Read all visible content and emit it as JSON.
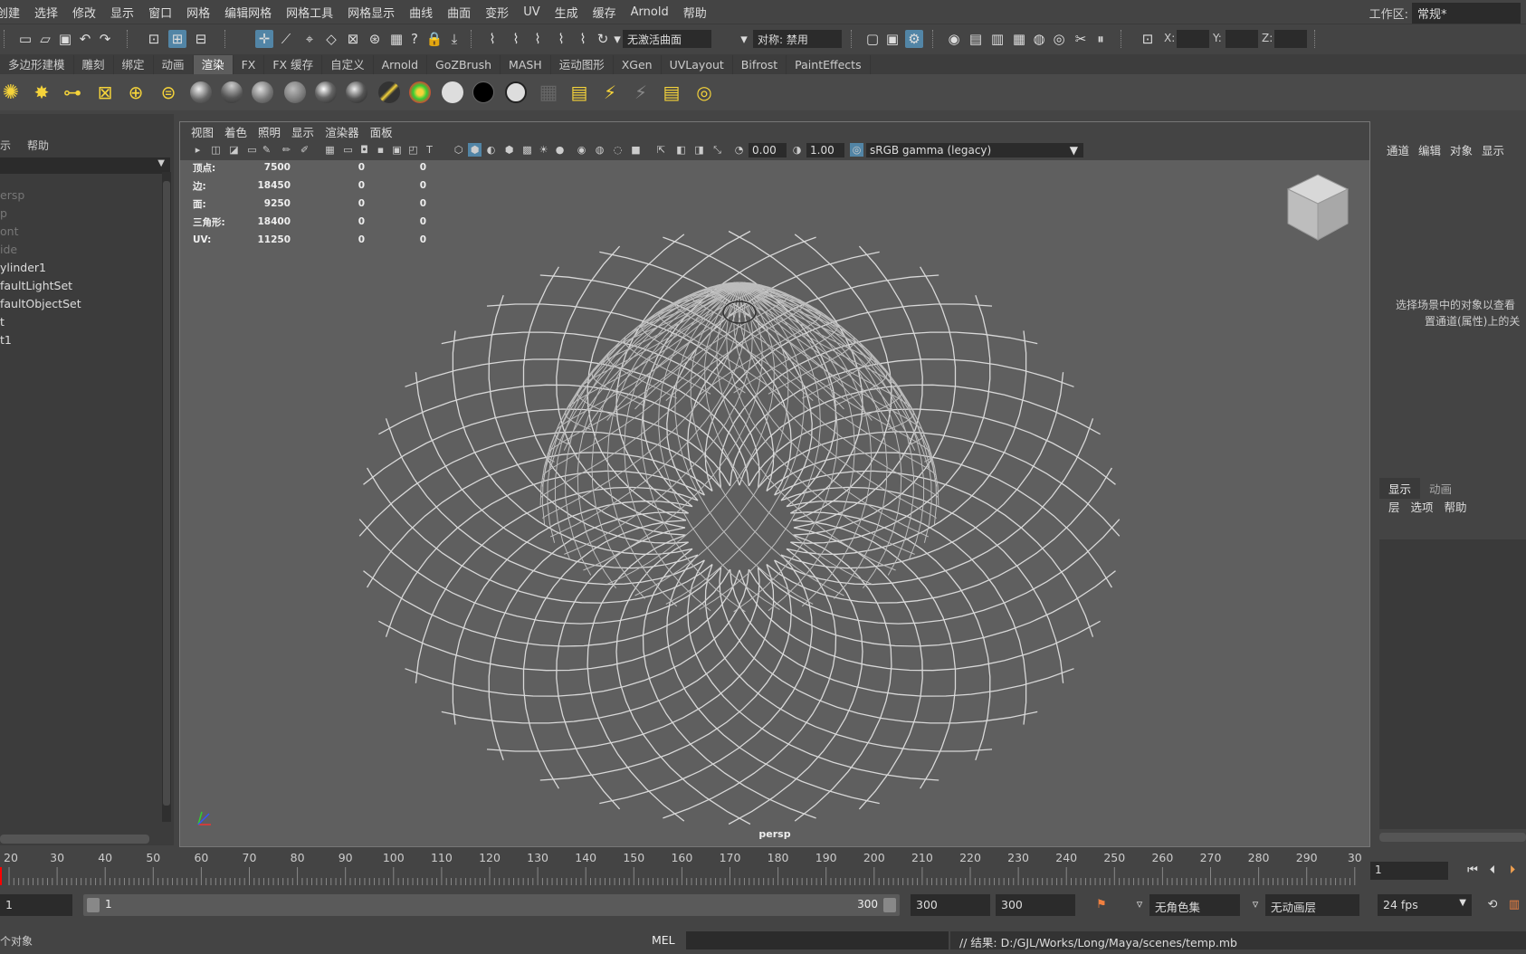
{
  "menubar": {
    "items": [
      "创建",
      "选择",
      "修改",
      "显示",
      "窗口",
      "网格",
      "编辑网格",
      "网格工具",
      "网格显示",
      "曲线",
      "曲面",
      "变形",
      "UV",
      "生成",
      "缓存",
      "Arnold",
      "帮助"
    ],
    "workspace_label": "工作区:",
    "workspace_value": "常规*"
  },
  "statusline": {
    "live_surface": "无激活曲面",
    "symmetry": "对称: 禁用",
    "x_label": "X:",
    "y_label": "Y:",
    "z_label": "Z:"
  },
  "shelf": {
    "tabs": [
      "多边形建模",
      "雕刻",
      "绑定",
      "动画",
      "渲染",
      "FX",
      "FX 缓存",
      "自定义",
      "Arnold",
      "GoZBrush",
      "MASH",
      "运动图形",
      "XGen",
      "UVLayout",
      "Bifrost",
      "PaintEffects"
    ],
    "active_tab": "渲染"
  },
  "outliner": {
    "menu": [
      "示",
      "帮助"
    ],
    "items": [
      {
        "label": "ersp",
        "dim": true
      },
      {
        "label": "p",
        "dim": true
      },
      {
        "label": "ont",
        "dim": true
      },
      {
        "label": "ide",
        "dim": true
      },
      {
        "label": "ylinder1",
        "dim": false
      },
      {
        "label": "faultLightSet",
        "dim": false
      },
      {
        "label": "faultObjectSet",
        "dim": false
      },
      {
        "label": "t",
        "dim": false
      },
      {
        "label": "t1",
        "dim": false
      }
    ]
  },
  "viewport": {
    "menu": [
      "视图",
      "着色",
      "照明",
      "显示",
      "渲染器",
      "面板"
    ],
    "exposure": "0.00",
    "gamma": "1.00",
    "color_space": "sRGB gamma (legacy)",
    "camera_label": "persp",
    "hud": [
      {
        "label": "顶点:",
        "value": "7500",
        "sel": "0",
        "tri": "0"
      },
      {
        "label": "边:",
        "value": "18450",
        "sel": "0",
        "tri": "0"
      },
      {
        "label": "面:",
        "value": "9250",
        "sel": "0",
        "tri": "0"
      },
      {
        "label": "三角形:",
        "value": "18400",
        "sel": "0",
        "tri": "0"
      },
      {
        "label": "UV:",
        "value": "11250",
        "sel": "0",
        "tri": "0"
      }
    ],
    "mesh_rings": 36
  },
  "channelbox": {
    "menu": [
      "通道",
      "编辑",
      "对象",
      "显示"
    ],
    "message_line1": "选择场景中的对象以查看",
    "message_line2": "置通道(属性)上的关"
  },
  "layers": {
    "tabs": [
      "显示",
      "动画"
    ],
    "menu": [
      "层",
      "选项",
      "帮助"
    ]
  },
  "timeslider": {
    "ticks": [
      "20",
      "30",
      "40",
      "50",
      "60",
      "70",
      "80",
      "90",
      "100",
      "110",
      "120",
      "130",
      "140",
      "150",
      "160",
      "170",
      "180",
      "190",
      "200",
      "210",
      "220",
      "230",
      "240",
      "250",
      "260",
      "270",
      "280",
      "290",
      "30"
    ],
    "current_frame": "1"
  },
  "range": {
    "start_field": "1",
    "slider_start": "1",
    "slider_end": "300",
    "anim_end": "300",
    "scene_end": "300",
    "character_set": "无角色集",
    "anim_layer": "无动画层",
    "fps": "24 fps"
  },
  "commandline": {
    "left_text": "个对象",
    "lang": "MEL",
    "result": "// 结果: D:/GJL/Works/Long/Maya/scenes/temp.mb"
  },
  "colors": {
    "accent": "#5285a6",
    "panel": "#444444",
    "viewport_bg": "#5f5f5f",
    "wire": "#dcdcdc"
  }
}
